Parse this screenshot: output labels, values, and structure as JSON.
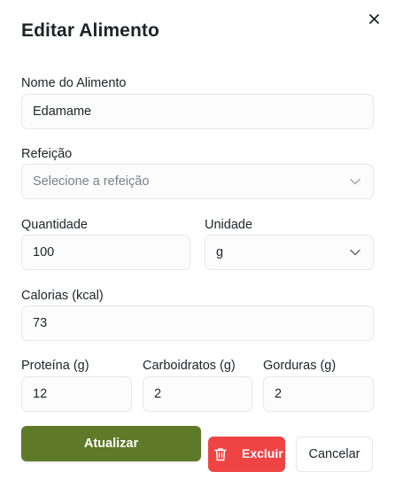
{
  "dialog": {
    "title": "Editar Alimento",
    "close_icon": "close-icon"
  },
  "fields": {
    "name": {
      "label": "Nome do Alimento",
      "value": "Edamame"
    },
    "meal": {
      "label": "Refeição",
      "placeholder": "Selecione a refeição"
    },
    "quantity": {
      "label": "Quantidade",
      "value": "100"
    },
    "unit": {
      "label": "Unidade",
      "value": "g"
    },
    "calories": {
      "label": "Calorias (kcal)",
      "value": "73"
    },
    "protein": {
      "label": "Proteína (g)",
      "value": "12"
    },
    "carbs": {
      "label": "Carboidratos (g)",
      "value": "2"
    },
    "fat": {
      "label": "Gorduras (g)",
      "value": "2"
    }
  },
  "actions": {
    "update_label": "Atualizar",
    "delete_label": "Excluir",
    "cancel_label": "Cancelar"
  },
  "colors": {
    "primary": "#5e7a29",
    "danger": "#ef4444"
  }
}
